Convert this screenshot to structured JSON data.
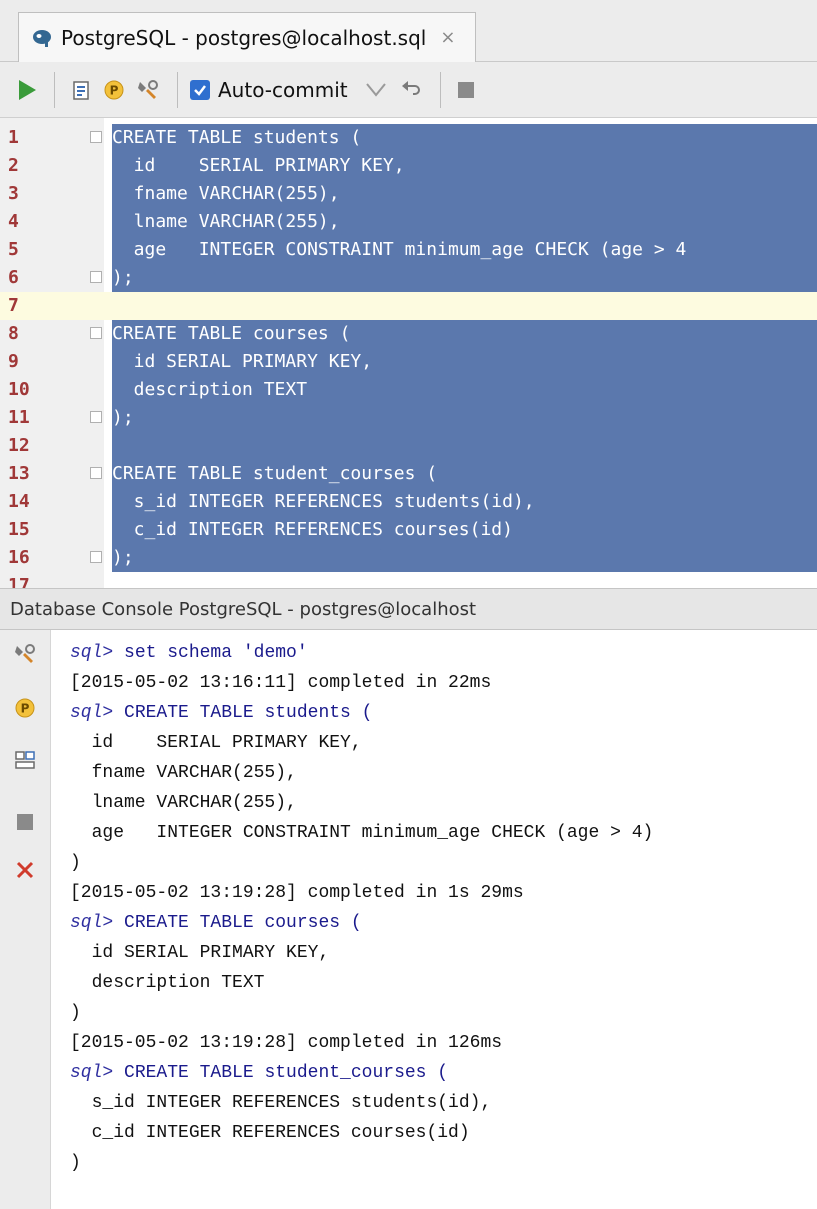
{
  "tab": {
    "title": "PostgreSQL - postgres@localhost.sql",
    "close": "×"
  },
  "toolbar": {
    "autocommit_label": "Auto-commit",
    "autocommit_checked": true,
    "icons": [
      "run-icon",
      "explain-plan-icon",
      "parameters-icon",
      "settings-icon",
      "autocommit-checkbox",
      "commit-icon",
      "rollback-icon",
      "stop-icon"
    ]
  },
  "editor": {
    "lines": [
      {
        "n": "1",
        "text": "CREATE TABLE students ("
      },
      {
        "n": "2",
        "text": "  id    SERIAL PRIMARY KEY,"
      },
      {
        "n": "3",
        "text": "  fname VARCHAR(255),"
      },
      {
        "n": "4",
        "text": "  lname VARCHAR(255),"
      },
      {
        "n": "5",
        "text": "  age   INTEGER CONSTRAINT minimum_age CHECK (age > 4"
      },
      {
        "n": "6",
        "text": ");"
      },
      {
        "n": "7",
        "text": ""
      },
      {
        "n": "8",
        "text": "CREATE TABLE courses ("
      },
      {
        "n": "9",
        "text": "  id SERIAL PRIMARY KEY,"
      },
      {
        "n": "10",
        "text": "  description TEXT"
      },
      {
        "n": "11",
        "text": ");"
      },
      {
        "n": "12",
        "text": ""
      },
      {
        "n": "13",
        "text": "CREATE TABLE student_courses ("
      },
      {
        "n": "14",
        "text": "  s_id INTEGER REFERENCES students(id),"
      },
      {
        "n": "15",
        "text": "  c_id INTEGER REFERENCES courses(id)"
      },
      {
        "n": "16",
        "text": ");"
      },
      {
        "n": "17",
        "text": ""
      }
    ]
  },
  "console": {
    "title": "Database Console PostgreSQL - postgres@localhost",
    "prompt": "sql>",
    "lines": [
      {
        "type": "cmd",
        "text": " set schema 'demo'"
      },
      {
        "type": "out",
        "text": "[2015-05-02 13:16:11] completed in 22ms"
      },
      {
        "type": "cmd",
        "text": " CREATE TABLE students ("
      },
      {
        "type": "out",
        "text": "  id    SERIAL PRIMARY KEY,"
      },
      {
        "type": "out",
        "text": "  fname VARCHAR(255),"
      },
      {
        "type": "out",
        "text": "  lname VARCHAR(255),"
      },
      {
        "type": "out",
        "text": "  age   INTEGER CONSTRAINT minimum_age CHECK (age > 4)"
      },
      {
        "type": "out",
        "text": ")"
      },
      {
        "type": "out",
        "text": "[2015-05-02 13:19:28] completed in 1s 29ms"
      },
      {
        "type": "cmd",
        "text": " CREATE TABLE courses ("
      },
      {
        "type": "out",
        "text": "  id SERIAL PRIMARY KEY,"
      },
      {
        "type": "out",
        "text": "  description TEXT"
      },
      {
        "type": "out",
        "text": ")"
      },
      {
        "type": "out",
        "text": "[2015-05-02 13:19:28] completed in 126ms"
      },
      {
        "type": "cmd",
        "text": " CREATE TABLE student_courses ("
      },
      {
        "type": "out",
        "text": "  s_id INTEGER REFERENCES students(id),"
      },
      {
        "type": "out",
        "text": "  c_id INTEGER REFERENCES courses(id)"
      },
      {
        "type": "out",
        "text": ")"
      }
    ]
  },
  "colors": {
    "selection": "#5b78ad",
    "line_number": "#a03838",
    "current_line": "#fdfbe0",
    "keyword": "#1a1a8c",
    "prompt": "#2f2fa0",
    "string": "#107010"
  }
}
